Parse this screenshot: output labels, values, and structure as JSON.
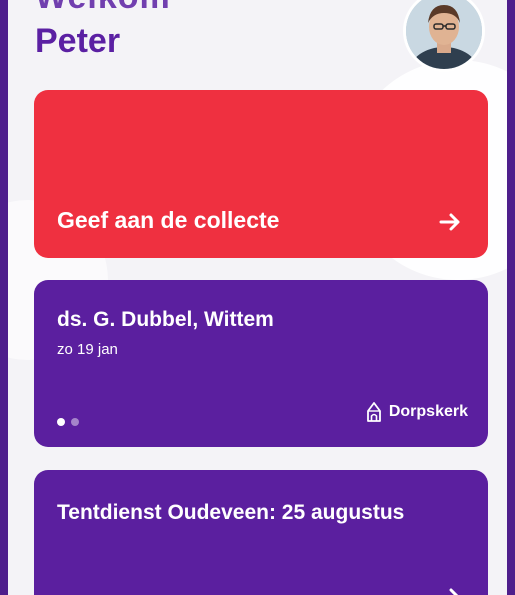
{
  "header": {
    "greeting_partial": "Welkom",
    "name": "Peter",
    "avatar_icon": "user-avatar-photo"
  },
  "collect_card": {
    "label": "Geef aan de collecte",
    "arrow_icon": "arrow-right-icon",
    "color": "#ef3040"
  },
  "service_card": {
    "title": "ds. G. Dubbel, Wittem",
    "date": "zo 19 jan",
    "church_icon": "church-icon",
    "church_name": "Dorpskerk",
    "carousel_total": 2,
    "carousel_active": 1,
    "color": "#5b1f9f"
  },
  "tent_card": {
    "title": "Tentdienst Oudeveen: 25 augustus",
    "arrow_icon": "arrow-right-icon",
    "color": "#5b1f9f"
  },
  "colors": {
    "brand_purple": "#5b20a3",
    "frame_purple": "#4e1e8c",
    "background": "#f4f3f7"
  }
}
